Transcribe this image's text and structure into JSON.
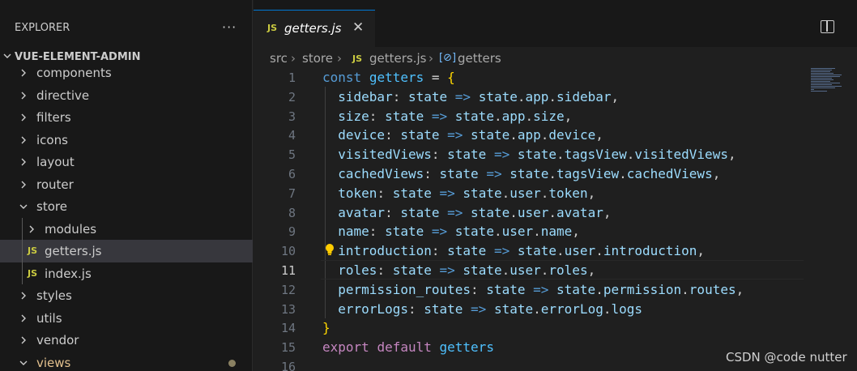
{
  "sidebar": {
    "title": "EXPLORER",
    "more": "···",
    "root": "VUE-ELEMENT-ADMIN",
    "items": [
      {
        "label": "components",
        "type": "folder",
        "depth": 1
      },
      {
        "label": "directive",
        "type": "folder",
        "depth": 1
      },
      {
        "label": "filters",
        "type": "folder",
        "depth": 1
      },
      {
        "label": "icons",
        "type": "folder",
        "depth": 1
      },
      {
        "label": "layout",
        "type": "folder",
        "depth": 1
      },
      {
        "label": "router",
        "type": "folder",
        "depth": 1
      },
      {
        "label": "store",
        "type": "folder-open",
        "depth": 1
      },
      {
        "label": "modules",
        "type": "folder",
        "depth": 2
      },
      {
        "label": "getters.js",
        "type": "js",
        "depth": 2,
        "selected": true
      },
      {
        "label": "index.js",
        "type": "js",
        "depth": 2
      },
      {
        "label": "styles",
        "type": "folder",
        "depth": 1
      },
      {
        "label": "utils",
        "type": "folder",
        "depth": 1
      },
      {
        "label": "vendor",
        "type": "folder",
        "depth": 1
      },
      {
        "label": "views",
        "type": "folder-open",
        "depth": 1,
        "modified": true
      }
    ]
  },
  "tab": {
    "badge": "JS",
    "label": "getters.js",
    "close": "✕"
  },
  "breadcrumb": {
    "p1": "src",
    "p2": "store",
    "badge": "JS",
    "p3": "getters.js",
    "p4": "getters"
  },
  "code": {
    "lines": [
      {
        "n": "1",
        "html": "<span class=\"k\">const</span> <span class=\"v\">getters</span> <span class=\"op\">=</span> <span class=\"br\">{</span>"
      },
      {
        "n": "2",
        "html": "  <span class=\"p\">sidebar</span>: <span class=\"p\">state</span> <span class=\"k\">=&gt;</span> <span class=\"p\">state</span>.<span class=\"p\">app</span>.<span class=\"p\">sidebar</span>,"
      },
      {
        "n": "3",
        "html": "  <span class=\"p\">size</span>: <span class=\"p\">state</span> <span class=\"k\">=&gt;</span> <span class=\"p\">state</span>.<span class=\"p\">app</span>.<span class=\"p\">size</span>,"
      },
      {
        "n": "4",
        "html": "  <span class=\"p\">device</span>: <span class=\"p\">state</span> <span class=\"k\">=&gt;</span> <span class=\"p\">state</span>.<span class=\"p\">app</span>.<span class=\"p\">device</span>,"
      },
      {
        "n": "5",
        "html": "  <span class=\"p\">visitedViews</span>: <span class=\"p\">state</span> <span class=\"k\">=&gt;</span> <span class=\"p\">state</span>.<span class=\"p\">tagsView</span>.<span class=\"p\">visitedViews</span>,"
      },
      {
        "n": "6",
        "html": "  <span class=\"p\">cachedViews</span>: <span class=\"p\">state</span> <span class=\"k\">=&gt;</span> <span class=\"p\">state</span>.<span class=\"p\">tagsView</span>.<span class=\"p\">cachedViews</span>,"
      },
      {
        "n": "7",
        "html": "  <span class=\"p\">token</span>: <span class=\"p\">state</span> <span class=\"k\">=&gt;</span> <span class=\"p\">state</span>.<span class=\"p\">user</span>.<span class=\"p\">token</span>,"
      },
      {
        "n": "8",
        "html": "  <span class=\"p\">avatar</span>: <span class=\"p\">state</span> <span class=\"k\">=&gt;</span> <span class=\"p\">state</span>.<span class=\"p\">user</span>.<span class=\"p\">avatar</span>,"
      },
      {
        "n": "9",
        "html": "  <span class=\"p\">name</span>: <span class=\"p\">state</span> <span class=\"k\">=&gt;</span> <span class=\"p\">state</span>.<span class=\"p\">user</span>.<span class=\"p\">name</span>,"
      },
      {
        "n": "10",
        "html": "  <span class=\"p\">introduction</span>: <span class=\"p\">state</span> <span class=\"k\">=&gt;</span> <span class=\"p\">state</span>.<span class=\"p\">user</span>.<span class=\"p\">introduction</span>,",
        "bulb": true
      },
      {
        "n": "11",
        "html": "  <span class=\"p\">roles</span>: <span class=\"p\">state</span> <span class=\"k\">=&gt;</span> <span class=\"p\">state</span>.<span class=\"p\">user</span>.<span class=\"p\">roles</span>,",
        "current": true
      },
      {
        "n": "12",
        "html": "  <span class=\"p\">permission_routes</span>: <span class=\"p\">state</span> <span class=\"k\">=&gt;</span> <span class=\"p\">state</span>.<span class=\"p\">permission</span>.<span class=\"p\">routes</span>,"
      },
      {
        "n": "13",
        "html": "  <span class=\"p\">errorLogs</span>: <span class=\"p\">state</span> <span class=\"k\">=&gt;</span> <span class=\"p\">state</span>.<span class=\"p\">errorLog</span>.<span class=\"p\">logs</span>"
      },
      {
        "n": "14",
        "html": "<span class=\"br\">}</span>"
      },
      {
        "n": "15",
        "html": "<span class=\"kc\">export</span> <span class=\"kc\">default</span> <span class=\"v\">getters</span>"
      },
      {
        "n": "16",
        "html": ""
      }
    ]
  },
  "watermark": "CSDN @code nutter"
}
